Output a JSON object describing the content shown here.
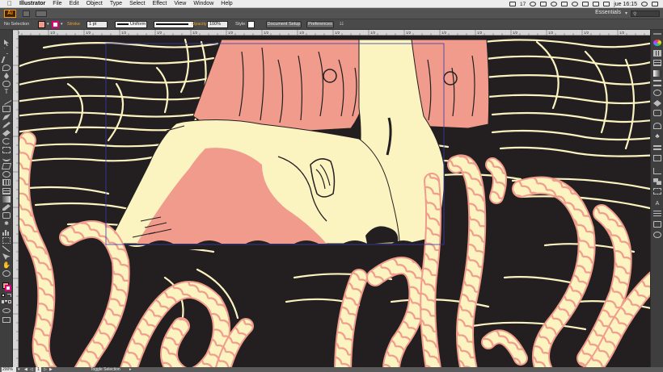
{
  "menubar": {
    "apple_icon": "apple-icon",
    "app_name": "Illustrator",
    "items": [
      "File",
      "Edit",
      "Object",
      "Type",
      "Select",
      "Effect",
      "View",
      "Window",
      "Help"
    ],
    "badge": "17",
    "clock": "jue 16:15"
  },
  "appbar": {
    "logo": "Ai",
    "workspace": "Essentials"
  },
  "control": {
    "selection": "No Selection",
    "stroke_label": "Stroke",
    "stroke_value": "1 pt",
    "profile": "Uniform",
    "opacity_label": "Opacity",
    "opacity_value": "100%",
    "style_label": "Style:",
    "document_setup": "Document Setup",
    "preferences": "Preferences"
  },
  "ruler": {
    "labels": [
      "1/2",
      "1/2",
      "1/2",
      "1/2",
      "1/2",
      "1/2",
      "1/2",
      "1/2",
      "1/2",
      "1/2",
      "1/2",
      "1/2",
      "1/2",
      "1/2",
      "1/2",
      "1/2",
      "1/2",
      "1/2"
    ]
  },
  "status": {
    "zoom": "200%",
    "artboard": "1",
    "tool_label": "Toggle Selection"
  },
  "colors": {
    "canvas_bg": "#231f20",
    "pink": "#f09b8b",
    "cream": "#fbf3c0",
    "ink": "#231f20",
    "accent_orange": "#ff9a00"
  }
}
